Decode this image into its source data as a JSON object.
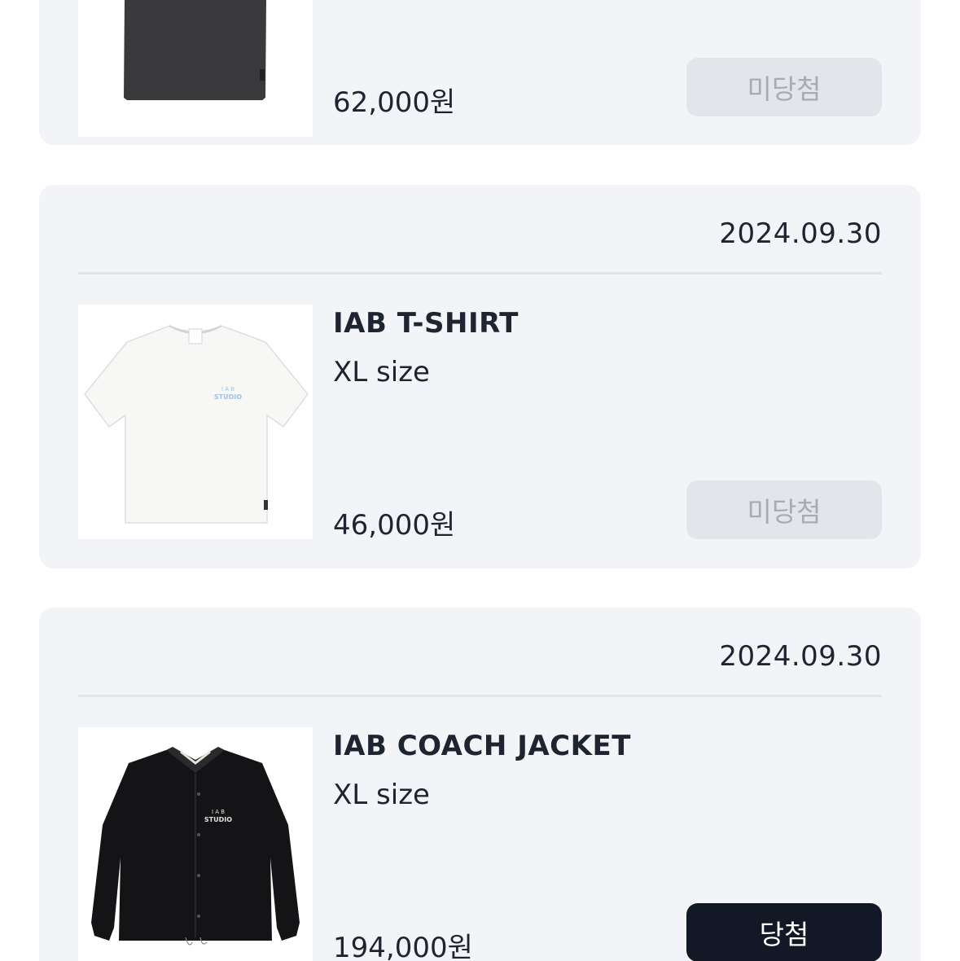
{
  "orders": [
    {
      "price": "62,000원",
      "status": "미당첨",
      "product_color": "#3a3a3c"
    },
    {
      "date": "2024.09.30",
      "name": "IAB T-SHIRT",
      "size": "XL size",
      "price": "46,000원",
      "status": "미당첨",
      "print_text": "STUDIO",
      "product_color": "#f7f7f5",
      "print_color": "#9cc3e8"
    },
    {
      "date": "2024.09.30",
      "name": "IAB COACH JACKET",
      "size": "XL size",
      "price": "194,000원",
      "status": "당첨",
      "print_text": "STUDIO",
      "product_color": "#141416"
    }
  ],
  "colors": {
    "card_bg": "#f3f4f7",
    "lose_btn_bg": "#e3e5ea",
    "lose_btn_text": "#a6abb5",
    "win_btn_bg": "#121826",
    "win_btn_text": "#ffffff"
  }
}
